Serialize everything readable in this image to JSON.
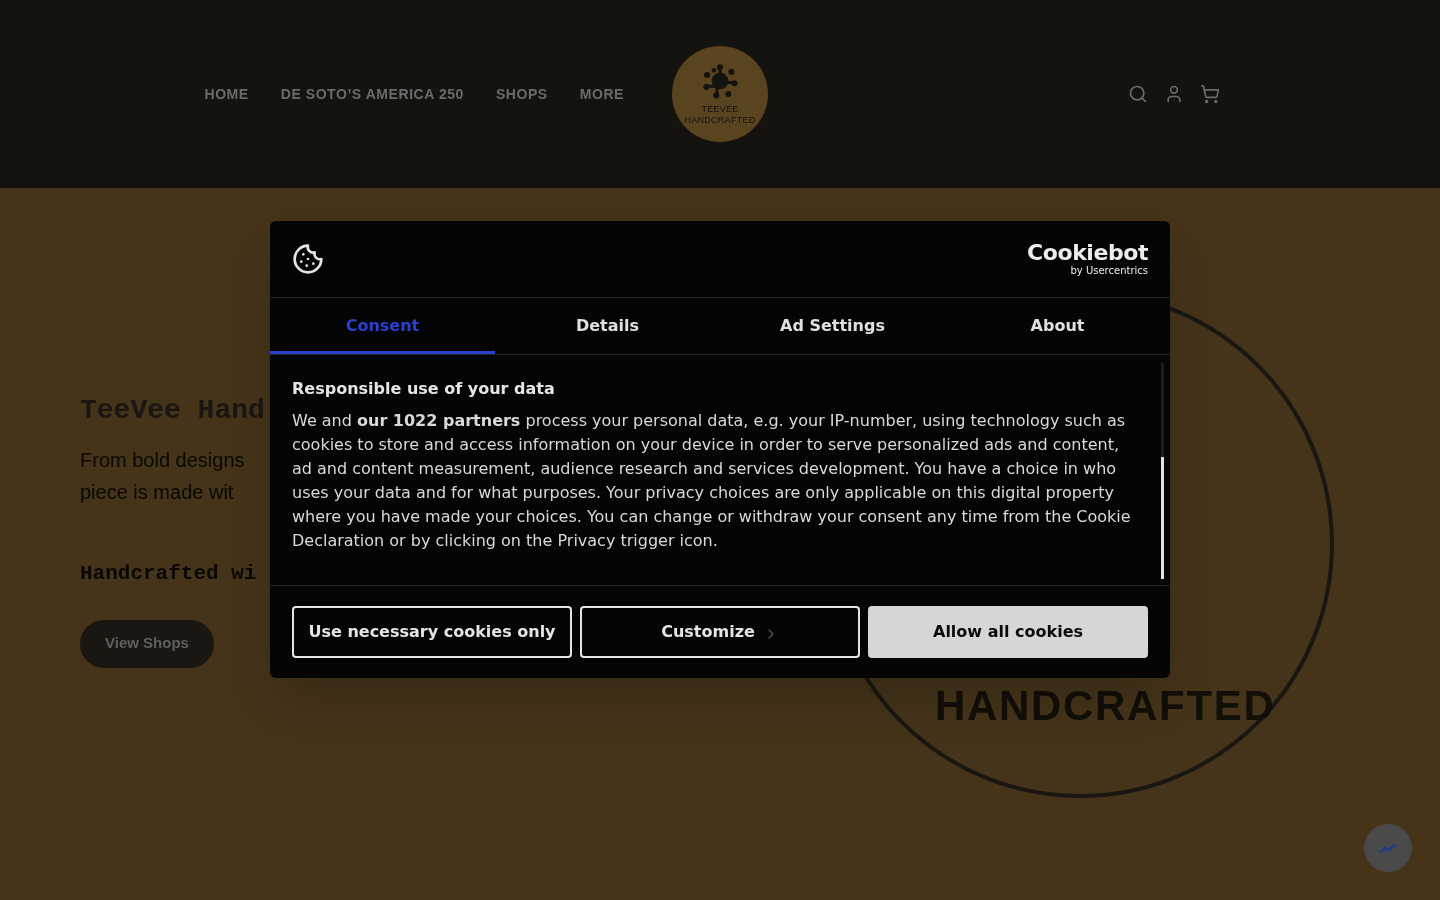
{
  "header": {
    "nav": [
      {
        "label": "HOME"
      },
      {
        "label": "DE SOTO’S AMERICA 250"
      },
      {
        "label": "SHOPS"
      },
      {
        "label": "MORE"
      }
    ],
    "logo": {
      "line1": "TEEVEE",
      "line2": "HANDCRAFTED"
    }
  },
  "hero": {
    "title": "TeeVee Hand",
    "subtitle_lines": [
      "From bold designs",
      "piece is made wit"
    ],
    "tagline": "Handcrafted wi",
    "button": "View Shops"
  },
  "big_logo": {
    "text": "HANDCRAFTED"
  },
  "dialog": {
    "brand": {
      "name": "Cookiebot",
      "byline": "by Usercentrics"
    },
    "tabs": [
      {
        "label": "Consent",
        "selected": true
      },
      {
        "label": "Details",
        "selected": false
      },
      {
        "label": "Ad Settings",
        "selected": false
      },
      {
        "label": "About",
        "selected": false
      }
    ],
    "heading": "Responsible use of your data",
    "body": "We and **our 1022 partners** process your personal data, e.g. your IP-number, using technology such as cookies to store and access information on your device in order to serve personalized ads and content, ad and content measurement, audience research and services development. You have a choice in who uses your data and for what purposes. Your privacy choices are only applicable on this digital property where you have made your choices. You can change or withdraw your consent any time from the Cookie Declaration or by clicking on the Privacy trigger icon.",
    "buttons": [
      {
        "label": "Use necessary cookies only",
        "kind": "outline"
      },
      {
        "label": "Customize",
        "kind": "outline-arrow"
      },
      {
        "label": "Allow all cookies",
        "kind": "filled"
      }
    ]
  }
}
